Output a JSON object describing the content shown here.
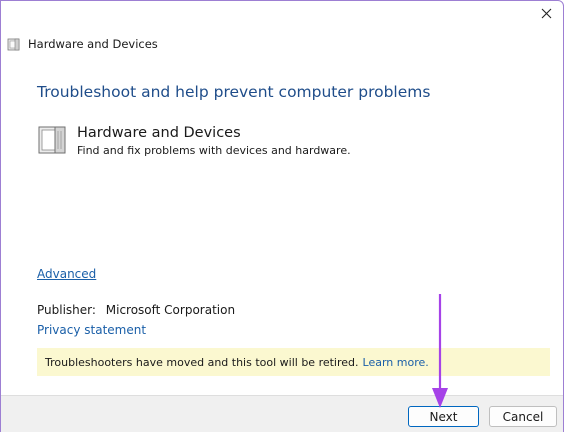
{
  "window": {
    "title": "Hardware and Devices",
    "close_icon": "close-icon"
  },
  "main": {
    "heading": "Troubleshoot and help prevent computer problems",
    "item": {
      "title": "Hardware and Devices",
      "description": "Find and fix problems with devices and hardware.",
      "icon": "hardware-devices-icon"
    },
    "advanced_link": "Advanced",
    "publisher_label": "Publisher:",
    "publisher_value": "Microsoft Corporation",
    "privacy_link": "Privacy statement",
    "notice": {
      "text": "Troubleshooters have moved and this tool will be retired.",
      "link": "Learn more."
    }
  },
  "footer": {
    "next_label": "Next",
    "cancel_label": "Cancel"
  },
  "colors": {
    "heading": "#1f4d8a",
    "link": "#1a5fa8",
    "notice_bg": "#fbf8d0",
    "footer_bg": "#f0f0f0",
    "annotation_arrow": "#a642e8"
  },
  "annotation": {
    "arrow_icon": "down-arrow-annotation-icon"
  }
}
